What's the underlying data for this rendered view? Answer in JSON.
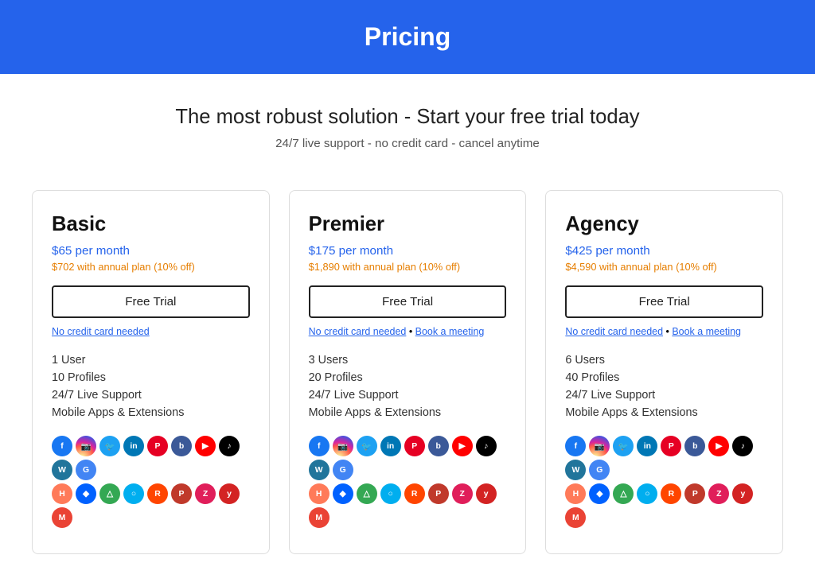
{
  "header": {
    "title": "Pricing"
  },
  "hero": {
    "headline": "The most robust solution - Start your free trial today",
    "subline": "24/7 live support - no credit card - cancel anytime"
  },
  "plans": [
    {
      "id": "basic",
      "name": "Basic",
      "price_main": "$65 per month",
      "price_annual": "$702 with annual plan (10% off)",
      "cta_label": "Free Trial",
      "credit_note": "No credit card needed",
      "book_meeting": null,
      "features": [
        "1 User",
        "10 Profiles",
        "24/7 Live Support",
        "Mobile Apps & Extensions"
      ]
    },
    {
      "id": "premier",
      "name": "Premier",
      "price_main": "$175 per month",
      "price_annual": "$1,890 with annual plan (10% off)",
      "cta_label": "Free Trial",
      "credit_note": "No credit card needed",
      "book_meeting": "Book a meeting",
      "features": [
        "3 Users",
        "20 Profiles",
        "24/7 Live Support",
        "Mobile Apps & Extensions"
      ]
    },
    {
      "id": "agency",
      "name": "Agency",
      "price_main": "$425 per month",
      "price_annual": "$4,590 with annual plan (10% off)",
      "cta_label": "Free Trial",
      "credit_note": "No credit card needed",
      "book_meeting": "Book a meeting",
      "features": [
        "6 Users",
        "40 Profiles",
        "24/7 Live Support",
        "Mobile Apps & Extensions"
      ]
    }
  ]
}
